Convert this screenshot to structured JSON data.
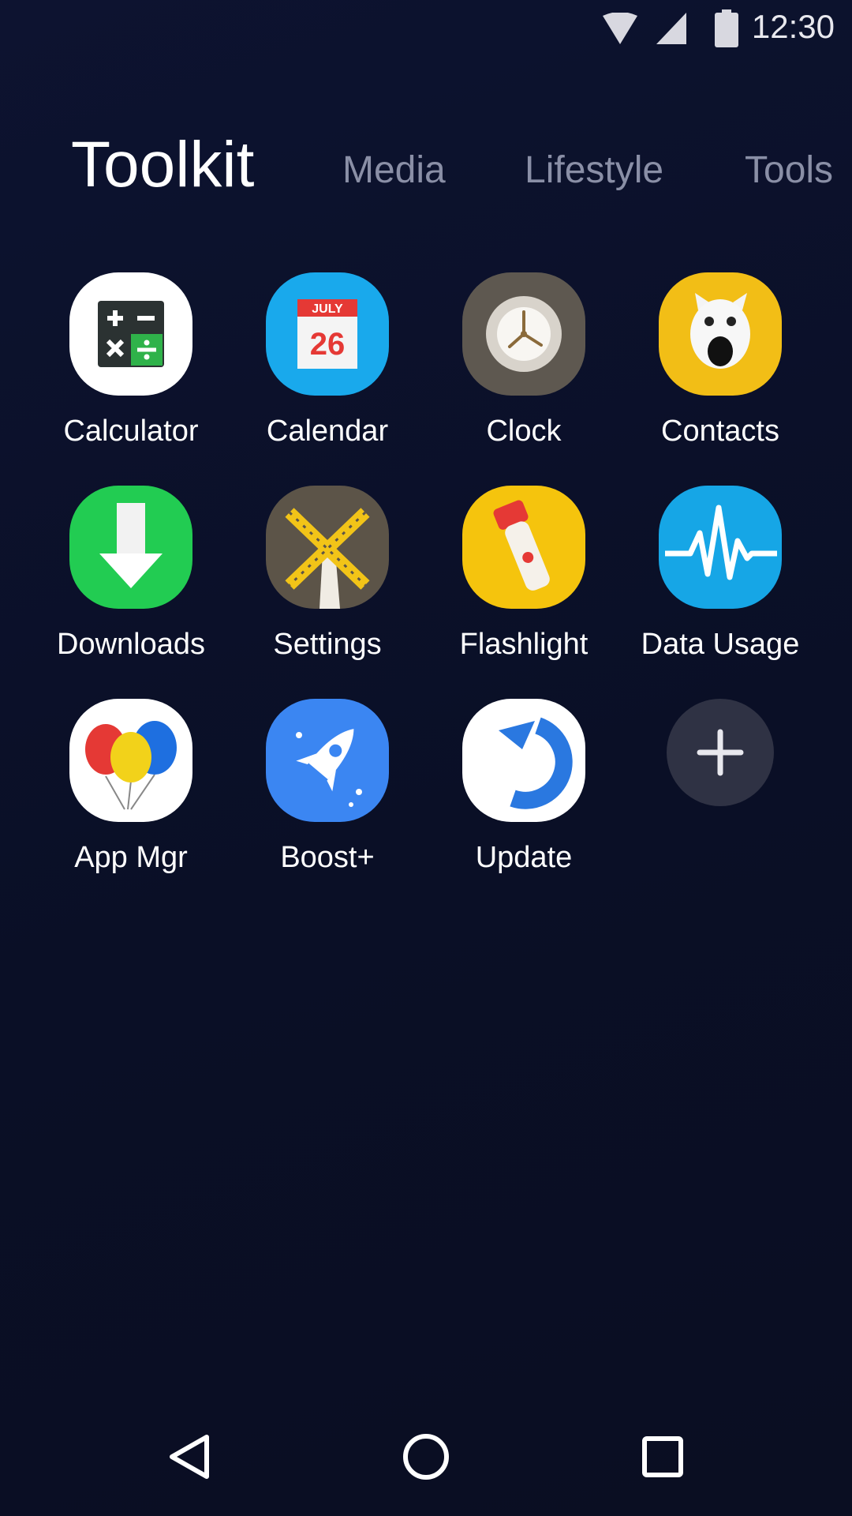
{
  "status_bar": {
    "time": "12:30",
    "icons": [
      "wifi-icon",
      "cellular-signal-icon",
      "battery-icon"
    ]
  },
  "tabs": [
    {
      "label": "Toolkit",
      "active": true
    },
    {
      "label": "Media",
      "active": false
    },
    {
      "label": "Lifestyle",
      "active": false
    },
    {
      "label": "Tools",
      "active": false
    }
  ],
  "apps": [
    {
      "label": "Calculator",
      "icon": "calculator-icon"
    },
    {
      "label": "Calendar",
      "icon": "calendar-icon",
      "icon_text": {
        "month": "JULY",
        "day": "26"
      }
    },
    {
      "label": "Clock",
      "icon": "clock-icon"
    },
    {
      "label": "Contacts",
      "icon": "contacts-icon"
    },
    {
      "label": "Downloads",
      "icon": "downloads-icon"
    },
    {
      "label": "Settings",
      "icon": "windmill-icon"
    },
    {
      "label": "Flashlight",
      "icon": "flashlight-icon"
    },
    {
      "label": "Data Usage",
      "icon": "pulse-icon"
    },
    {
      "label": "App Mgr",
      "icon": "balloons-icon"
    },
    {
      "label": "Boost+",
      "icon": "rocket-icon"
    },
    {
      "label": "Update",
      "icon": "refresh-icon"
    }
  ],
  "add_button": {
    "icon": "plus-icon"
  },
  "nav_bar": {
    "icons": [
      "back-icon",
      "home-icon",
      "recents-icon"
    ]
  },
  "colors": {
    "background": "#0b1028",
    "tab_active": "#ffffff",
    "tab_inactive": "#8a8fa6",
    "add_button_bg": "#2f3244"
  }
}
